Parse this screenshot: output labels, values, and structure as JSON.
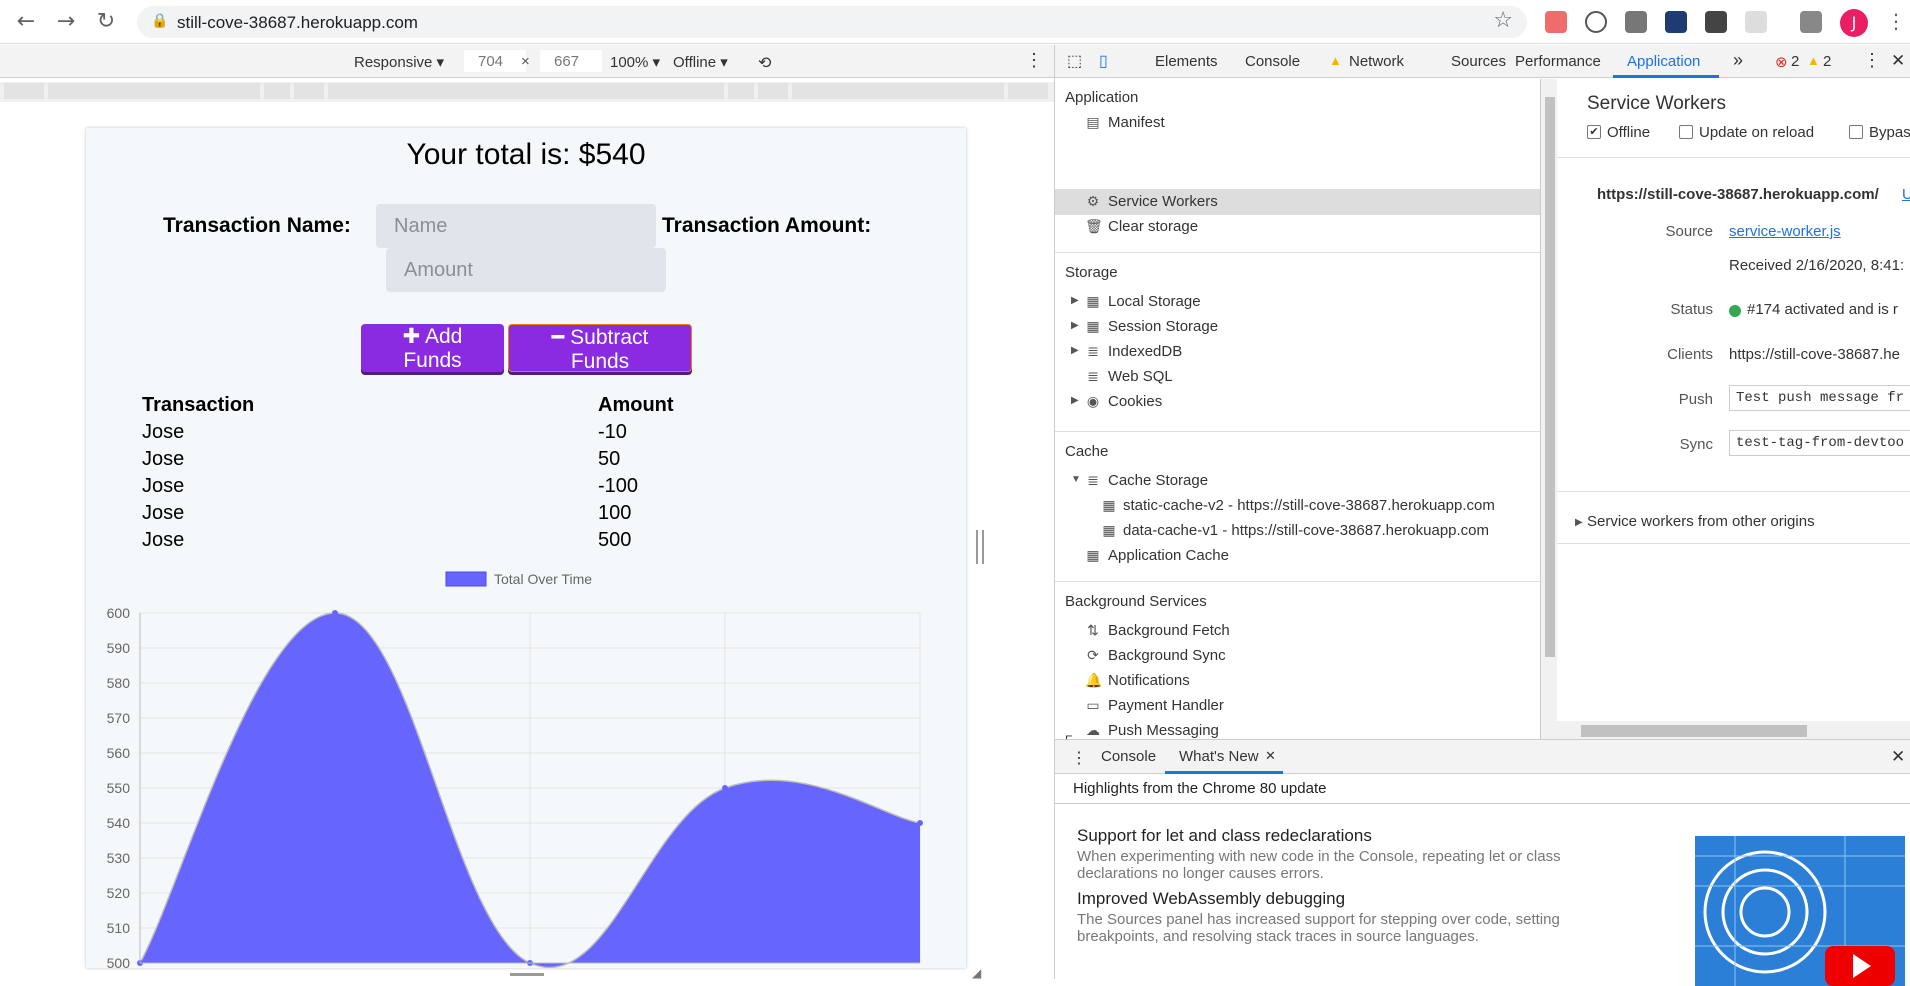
{
  "browser": {
    "url": "still-cove-38687.herokuapp.com",
    "profile_initial": "J"
  },
  "device_toolbar": {
    "mode": "Responsive",
    "width": "704",
    "height": "667",
    "zoom": "100%",
    "network": "Offline"
  },
  "app": {
    "total_text": "Your total is: $540",
    "name_label": "Transaction Name:",
    "name_placeholder": "Name",
    "amount_label": "Transaction Amount:",
    "amount_placeholder": "Amount",
    "add_button": "Add Funds",
    "subtract_button": "Subtract Funds",
    "table_headers": [
      "Transaction",
      "Amount"
    ],
    "transactions": [
      {
        "name": "Jose",
        "amount": "-10"
      },
      {
        "name": "Jose",
        "amount": "50"
      },
      {
        "name": "Jose",
        "amount": "-100"
      },
      {
        "name": "Jose",
        "amount": "100"
      },
      {
        "name": "Jose",
        "amount": "500"
      }
    ]
  },
  "chart_data": {
    "type": "area",
    "series": [
      {
        "name": "Total Over Time",
        "values": [
          500,
          600,
          500,
          550,
          540
        ]
      }
    ],
    "ylim": [
      500,
      600
    ],
    "yticks": [
      500,
      510,
      520,
      530,
      540,
      550,
      560,
      570,
      580,
      590,
      600
    ],
    "grid": true,
    "legend": "top",
    "color": "#6666ff"
  },
  "devtools": {
    "tabs": [
      "Elements",
      "Console",
      "Network",
      "Sources",
      "Performance",
      "Application"
    ],
    "active_tab": "Application",
    "more": "»",
    "error_count": "2",
    "warning_count": "2",
    "sidebar": {
      "application_header": "Application",
      "application_items": [
        "Manifest",
        "Service Workers",
        "Clear storage"
      ],
      "storage_header": "Storage",
      "storage_items": [
        "Local Storage",
        "Session Storage",
        "IndexedDB",
        "Web SQL",
        "Cookies"
      ],
      "cache_header": "Cache",
      "cache_storage": "Cache Storage",
      "cache_entries": [
        "static-cache-v2 - https://still-cove-38687.herokuapp.com",
        "data-cache-v1 - https://still-cove-38687.herokuapp.com"
      ],
      "application_cache": "Application Cache",
      "background_header": "Background Services",
      "background_items": [
        "Background Fetch",
        "Background Sync",
        "Notifications",
        "Payment Handler",
        "Push Messaging"
      ],
      "cut_header": "F"
    },
    "service_workers": {
      "title": "Service Workers",
      "offline_label": "Offline",
      "update_label": "Update on reload",
      "bypass_label": "Bypass for",
      "origin": "https://still-cove-38687.herokuapp.com/",
      "origin_link": "U",
      "source_label": "Source",
      "source_value": "service-worker.js",
      "received": "Received 2/16/2020, 8:41:",
      "status_label": "Status",
      "status_value": "#174 activated and is r",
      "clients_label": "Clients",
      "clients_value": "https://still-cove-38687.he",
      "push_label": "Push",
      "push_value": "Test push message fr",
      "sync_label": "Sync",
      "sync_value": "test-tag-from-devtoo",
      "other_origins": "Service workers from other origins"
    },
    "drawer": {
      "tabs": [
        "Console",
        "What's New"
      ],
      "highlights": "Highlights from the Chrome 80 update",
      "notes": [
        {
          "title": "Support for let and class redeclarations",
          "body": "When experimenting with new code in the Console, repeating let or class declarations no longer causes errors."
        },
        {
          "title": "Improved WebAssembly debugging",
          "body": "The Sources panel has increased support for stepping over code, setting breakpoints, and resolving stack traces in source languages."
        }
      ]
    }
  }
}
